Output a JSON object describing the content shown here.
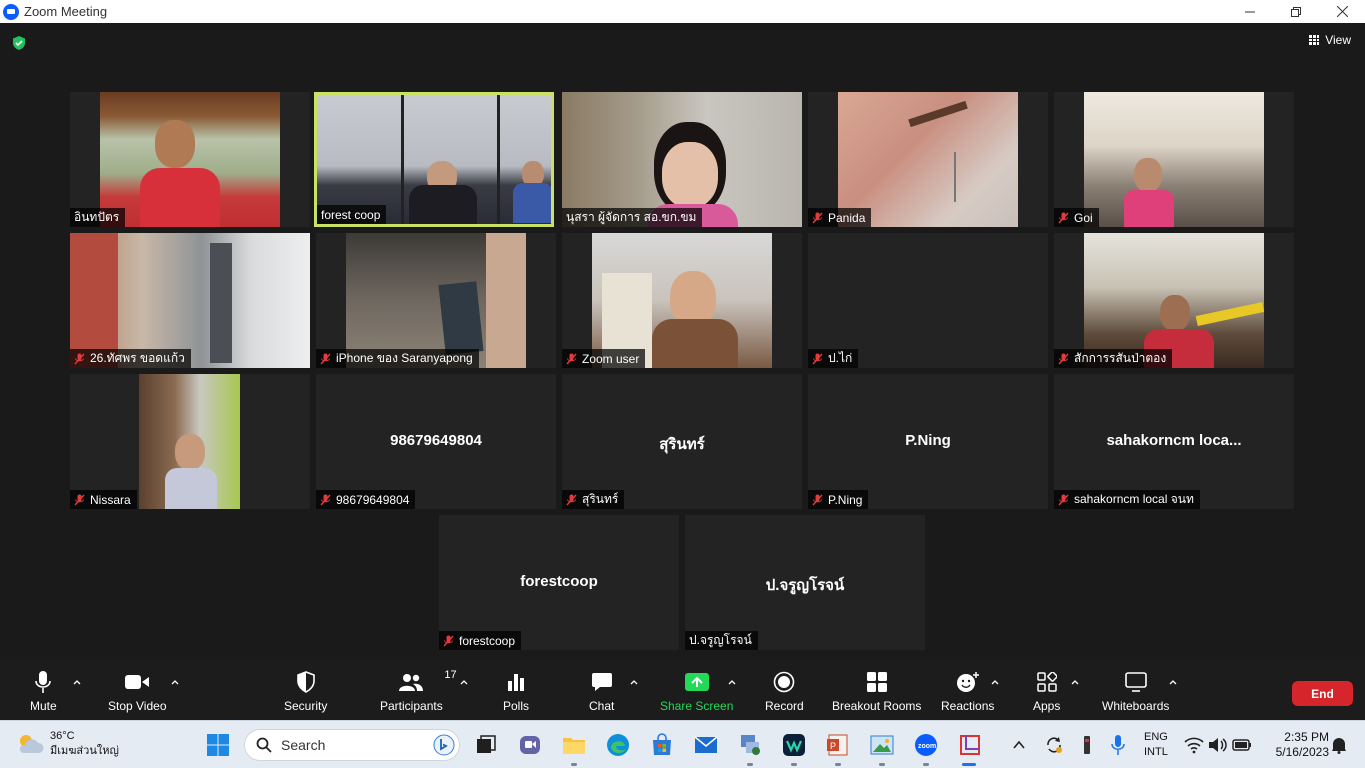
{
  "window": {
    "title": "Zoom Meeting"
  },
  "meeting": {
    "view_label": "View"
  },
  "participants": [
    {
      "name": "อินทปัตร",
      "muted": false
    },
    {
      "name": "forest coop",
      "muted": false,
      "active": true
    },
    {
      "name": "นุสรา ผู้จัดการ สอ.ขก.ขม",
      "muted": false
    },
    {
      "name": "Panida",
      "muted": true
    },
    {
      "name": "Goi",
      "muted": true
    },
    {
      "name": "26.ทัศพร ขอดแก้ว",
      "muted": true
    },
    {
      "name": "iPhone ของ Saranyapong",
      "muted": true
    },
    {
      "name": "Zoom user",
      "muted": true
    },
    {
      "name": "ป.ไก่",
      "muted": true
    },
    {
      "name": "สักการรสันป่าตอง",
      "muted": true
    },
    {
      "name": "Nissara",
      "muted": true
    },
    {
      "name": "98679649804",
      "muted": true,
      "display": "98679649804"
    },
    {
      "name": "สุรินทร์",
      "muted": true,
      "display": "สุรินทร์"
    },
    {
      "name": "P.Ning",
      "muted": true,
      "display": "P.Ning"
    },
    {
      "name": "sahakorncm local จนท",
      "muted": true,
      "display": "sahakorncm  loca..."
    },
    {
      "name": "forestcoop",
      "muted": true,
      "display": "forestcoop"
    },
    {
      "name": "ป.จรูญโรจน์",
      "muted": false,
      "display": "ป.จรูญโรจน์"
    }
  ],
  "toolbar": {
    "mute": "Mute",
    "stop_video": "Stop Video",
    "security": "Security",
    "participants": "Participants",
    "participants_count": "17",
    "polls": "Polls",
    "chat": "Chat",
    "share_screen": "Share Screen",
    "record": "Record",
    "breakout_rooms": "Breakout Rooms",
    "reactions": "Reactions",
    "apps": "Apps",
    "whiteboards": "Whiteboards",
    "end": "End"
  },
  "taskbar": {
    "weather_temp": "36°C",
    "weather_desc": "มีเมฆส่วนใหญ่",
    "search_placeholder": "Search",
    "lang_top": "ENG",
    "lang_bottom": "INTL",
    "time": "2:35 PM",
    "date": "5/16/2023"
  },
  "colors": {
    "active_speaker": "#c9e265",
    "end_button": "#d7262b",
    "share_screen": "#23d959",
    "meeting_bg": "#1a1a1a",
    "tile_bg": "#232323"
  }
}
